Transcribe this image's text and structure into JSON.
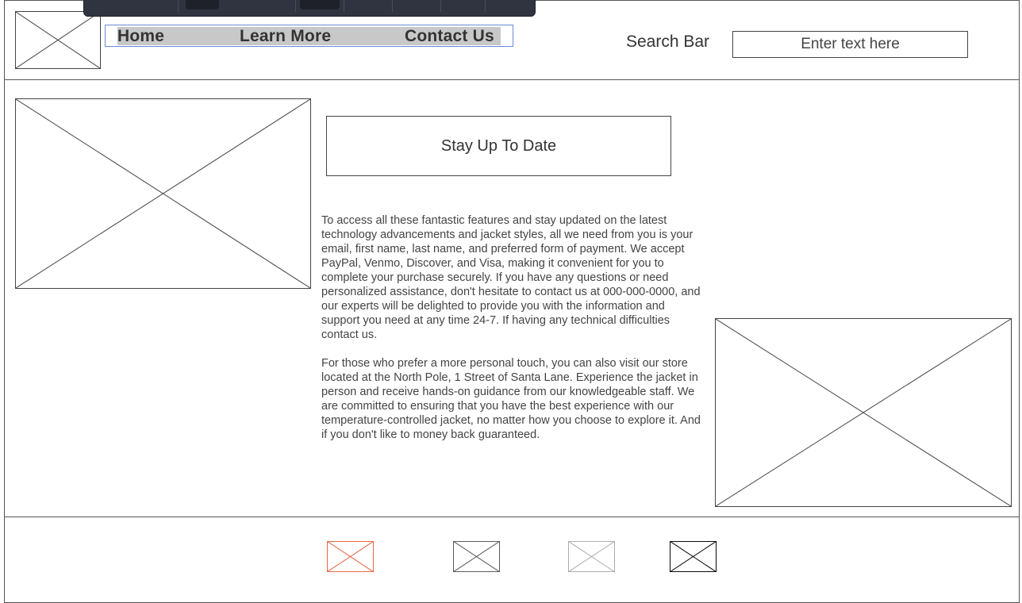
{
  "nav": {
    "items": [
      {
        "label": "Home"
      },
      {
        "label": "Learn More"
      },
      {
        "label": "Contact Us"
      }
    ]
  },
  "search": {
    "label": "Search Bar",
    "placeholder": "Enter text here"
  },
  "main": {
    "heading_box": "Stay Up To Date",
    "paragraph_1": "To access all these fantastic features and stay updated on the latest technology advancements and jacket styles, all we need from you is your email, first name, last name, and preferred form of payment. We accept PayPal, Venmo, Discover, and Visa, making it convenient for you to complete your purchase securely. If you have any questions or need personalized assistance, don't hesitate to contact us at 000-000-0000, and our experts will be delighted to provide you with the information and support you need at any time 24-7. If having any technical difficulties contact us.",
    "paragraph_2": "For those who prefer a more personal touch, you can also visit our store located at the North Pole, 1 Street of Santa Lane. Experience the jacket in person and receive hands-on guidance from our knowledgeable staff. We are committed to ensuring that you have the best experience with our temperature-controlled jacket, no matter how you choose to explore it. And if you don't like to money back guaranteed."
  },
  "footer": {
    "icons": [
      {
        "name": "footer-icon-1",
        "color": "#e8603c"
      },
      {
        "name": "footer-icon-2",
        "color": "#555555"
      },
      {
        "name": "footer-icon-3",
        "color": "#aaaaaa"
      },
      {
        "name": "footer-icon-4",
        "color": "#000000"
      }
    ]
  }
}
